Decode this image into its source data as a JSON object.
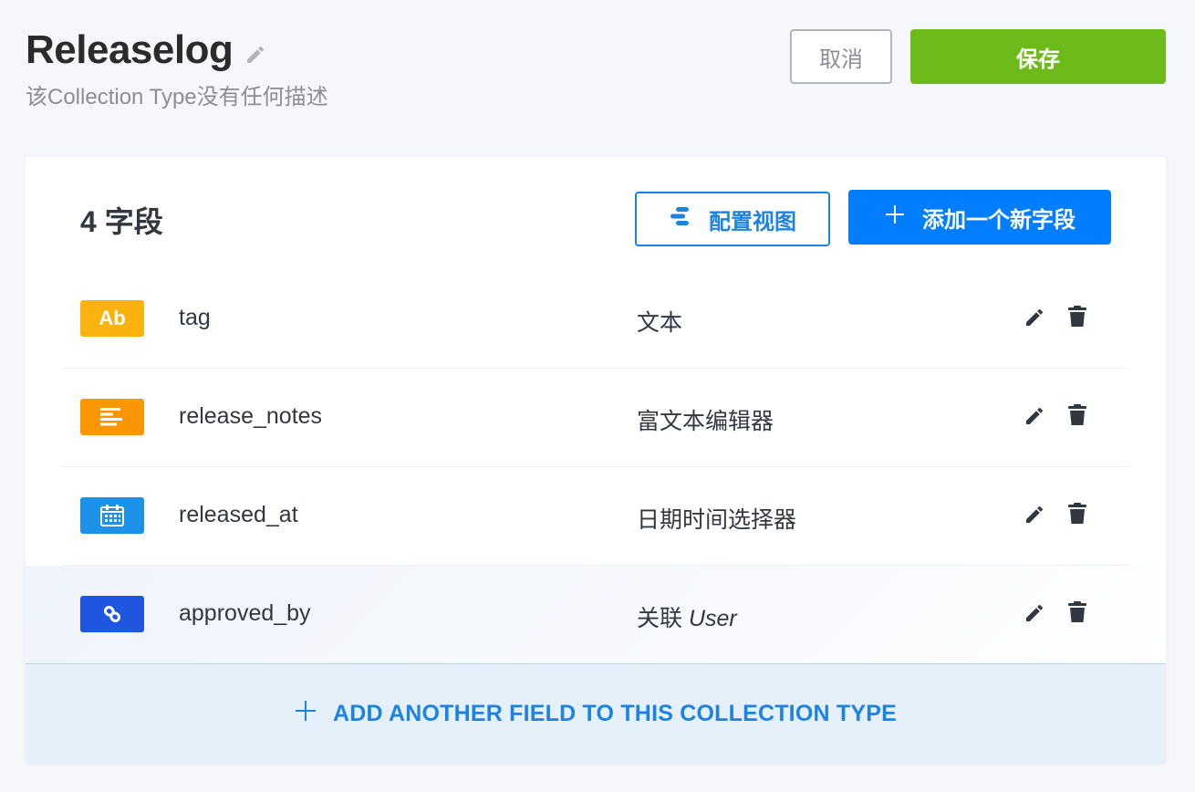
{
  "header": {
    "title": "Releaselog",
    "subtitle": "该Collection Type没有任何描述",
    "cancel_label": "取消",
    "save_label": "保存"
  },
  "fields_panel": {
    "count_label": "4 字段",
    "configure_view_label": "配置视图",
    "add_field_label": "添加一个新字段",
    "add_another_label": "ADD ANOTHER FIELD TO THIS COLLECTION TYPE"
  },
  "fields": [
    {
      "name": "tag",
      "type": "文本",
      "icon": "text-icon",
      "icon_text": "Ab",
      "color": "#fab20f"
    },
    {
      "name": "release_notes",
      "type": "富文本编辑器",
      "icon": "richtext-icon",
      "color": "#fb9600"
    },
    {
      "name": "released_at",
      "type": "日期时间选择器",
      "icon": "calendar-icon",
      "color": "#1c91e7"
    },
    {
      "name": "approved_by",
      "type": "关联",
      "type_target": "User",
      "icon": "link-icon",
      "color": "#1e56e0"
    }
  ],
  "colors": {
    "save": "#6dbb1a",
    "primary": "#007eff",
    "background": "#f6f7fb"
  }
}
